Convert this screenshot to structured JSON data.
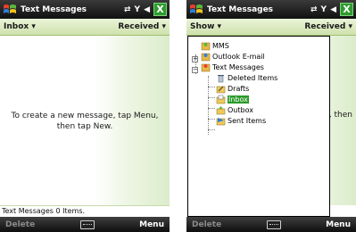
{
  "left_screen": {
    "title": "Text Messages",
    "header_left": "Inbox ▾",
    "header_right": "Received ▾",
    "empty_message": "To create a new message, tap Menu, then tap New.",
    "status_line": "Text Messages  0 Items.",
    "softkey_left": "Delete",
    "softkey_right": "Menu"
  },
  "right_screen": {
    "title": "Text Messages",
    "header_left": "Show ▾",
    "header_right": "Received ▾",
    "partial_text": ", then",
    "softkey_left": "Delete",
    "softkey_right": "Menu",
    "folder_tree": {
      "mms": "MMS",
      "outlook": "Outlook E-mail",
      "text_messages": "Text Messages",
      "deleted": "Deleted Items",
      "drafts": "Drafts",
      "inbox": "Inbox",
      "outbox": "Outbox",
      "sent": "Sent Items"
    }
  },
  "status_icons": {
    "connectivity": "⇄",
    "signal": "Y",
    "volume": "◀"
  },
  "close_label": "X"
}
